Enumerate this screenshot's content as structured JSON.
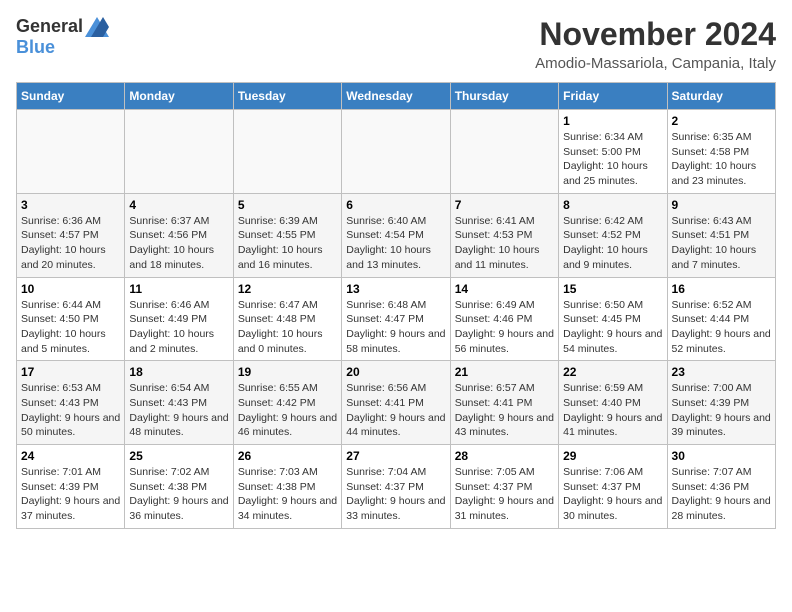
{
  "header": {
    "logo_general": "General",
    "logo_blue": "Blue",
    "month": "November 2024",
    "location": "Amodio-Massariola, Campania, Italy"
  },
  "weekdays": [
    "Sunday",
    "Monday",
    "Tuesday",
    "Wednesday",
    "Thursday",
    "Friday",
    "Saturday"
  ],
  "weeks": [
    [
      {
        "day": "",
        "detail": ""
      },
      {
        "day": "",
        "detail": ""
      },
      {
        "day": "",
        "detail": ""
      },
      {
        "day": "",
        "detail": ""
      },
      {
        "day": "",
        "detail": ""
      },
      {
        "day": "1",
        "detail": "Sunrise: 6:34 AM\nSunset: 5:00 PM\nDaylight: 10 hours and 25 minutes."
      },
      {
        "day": "2",
        "detail": "Sunrise: 6:35 AM\nSunset: 4:58 PM\nDaylight: 10 hours and 23 minutes."
      }
    ],
    [
      {
        "day": "3",
        "detail": "Sunrise: 6:36 AM\nSunset: 4:57 PM\nDaylight: 10 hours and 20 minutes."
      },
      {
        "day": "4",
        "detail": "Sunrise: 6:37 AM\nSunset: 4:56 PM\nDaylight: 10 hours and 18 minutes."
      },
      {
        "day": "5",
        "detail": "Sunrise: 6:39 AM\nSunset: 4:55 PM\nDaylight: 10 hours and 16 minutes."
      },
      {
        "day": "6",
        "detail": "Sunrise: 6:40 AM\nSunset: 4:54 PM\nDaylight: 10 hours and 13 minutes."
      },
      {
        "day": "7",
        "detail": "Sunrise: 6:41 AM\nSunset: 4:53 PM\nDaylight: 10 hours and 11 minutes."
      },
      {
        "day": "8",
        "detail": "Sunrise: 6:42 AM\nSunset: 4:52 PM\nDaylight: 10 hours and 9 minutes."
      },
      {
        "day": "9",
        "detail": "Sunrise: 6:43 AM\nSunset: 4:51 PM\nDaylight: 10 hours and 7 minutes."
      }
    ],
    [
      {
        "day": "10",
        "detail": "Sunrise: 6:44 AM\nSunset: 4:50 PM\nDaylight: 10 hours and 5 minutes."
      },
      {
        "day": "11",
        "detail": "Sunrise: 6:46 AM\nSunset: 4:49 PM\nDaylight: 10 hours and 2 minutes."
      },
      {
        "day": "12",
        "detail": "Sunrise: 6:47 AM\nSunset: 4:48 PM\nDaylight: 10 hours and 0 minutes."
      },
      {
        "day": "13",
        "detail": "Sunrise: 6:48 AM\nSunset: 4:47 PM\nDaylight: 9 hours and 58 minutes."
      },
      {
        "day": "14",
        "detail": "Sunrise: 6:49 AM\nSunset: 4:46 PM\nDaylight: 9 hours and 56 minutes."
      },
      {
        "day": "15",
        "detail": "Sunrise: 6:50 AM\nSunset: 4:45 PM\nDaylight: 9 hours and 54 minutes."
      },
      {
        "day": "16",
        "detail": "Sunrise: 6:52 AM\nSunset: 4:44 PM\nDaylight: 9 hours and 52 minutes."
      }
    ],
    [
      {
        "day": "17",
        "detail": "Sunrise: 6:53 AM\nSunset: 4:43 PM\nDaylight: 9 hours and 50 minutes."
      },
      {
        "day": "18",
        "detail": "Sunrise: 6:54 AM\nSunset: 4:43 PM\nDaylight: 9 hours and 48 minutes."
      },
      {
        "day": "19",
        "detail": "Sunrise: 6:55 AM\nSunset: 4:42 PM\nDaylight: 9 hours and 46 minutes."
      },
      {
        "day": "20",
        "detail": "Sunrise: 6:56 AM\nSunset: 4:41 PM\nDaylight: 9 hours and 44 minutes."
      },
      {
        "day": "21",
        "detail": "Sunrise: 6:57 AM\nSunset: 4:41 PM\nDaylight: 9 hours and 43 minutes."
      },
      {
        "day": "22",
        "detail": "Sunrise: 6:59 AM\nSunset: 4:40 PM\nDaylight: 9 hours and 41 minutes."
      },
      {
        "day": "23",
        "detail": "Sunrise: 7:00 AM\nSunset: 4:39 PM\nDaylight: 9 hours and 39 minutes."
      }
    ],
    [
      {
        "day": "24",
        "detail": "Sunrise: 7:01 AM\nSunset: 4:39 PM\nDaylight: 9 hours and 37 minutes."
      },
      {
        "day": "25",
        "detail": "Sunrise: 7:02 AM\nSunset: 4:38 PM\nDaylight: 9 hours and 36 minutes."
      },
      {
        "day": "26",
        "detail": "Sunrise: 7:03 AM\nSunset: 4:38 PM\nDaylight: 9 hours and 34 minutes."
      },
      {
        "day": "27",
        "detail": "Sunrise: 7:04 AM\nSunset: 4:37 PM\nDaylight: 9 hours and 33 minutes."
      },
      {
        "day": "28",
        "detail": "Sunrise: 7:05 AM\nSunset: 4:37 PM\nDaylight: 9 hours and 31 minutes."
      },
      {
        "day": "29",
        "detail": "Sunrise: 7:06 AM\nSunset: 4:37 PM\nDaylight: 9 hours and 30 minutes."
      },
      {
        "day": "30",
        "detail": "Sunrise: 7:07 AM\nSunset: 4:36 PM\nDaylight: 9 hours and 28 minutes."
      }
    ]
  ]
}
